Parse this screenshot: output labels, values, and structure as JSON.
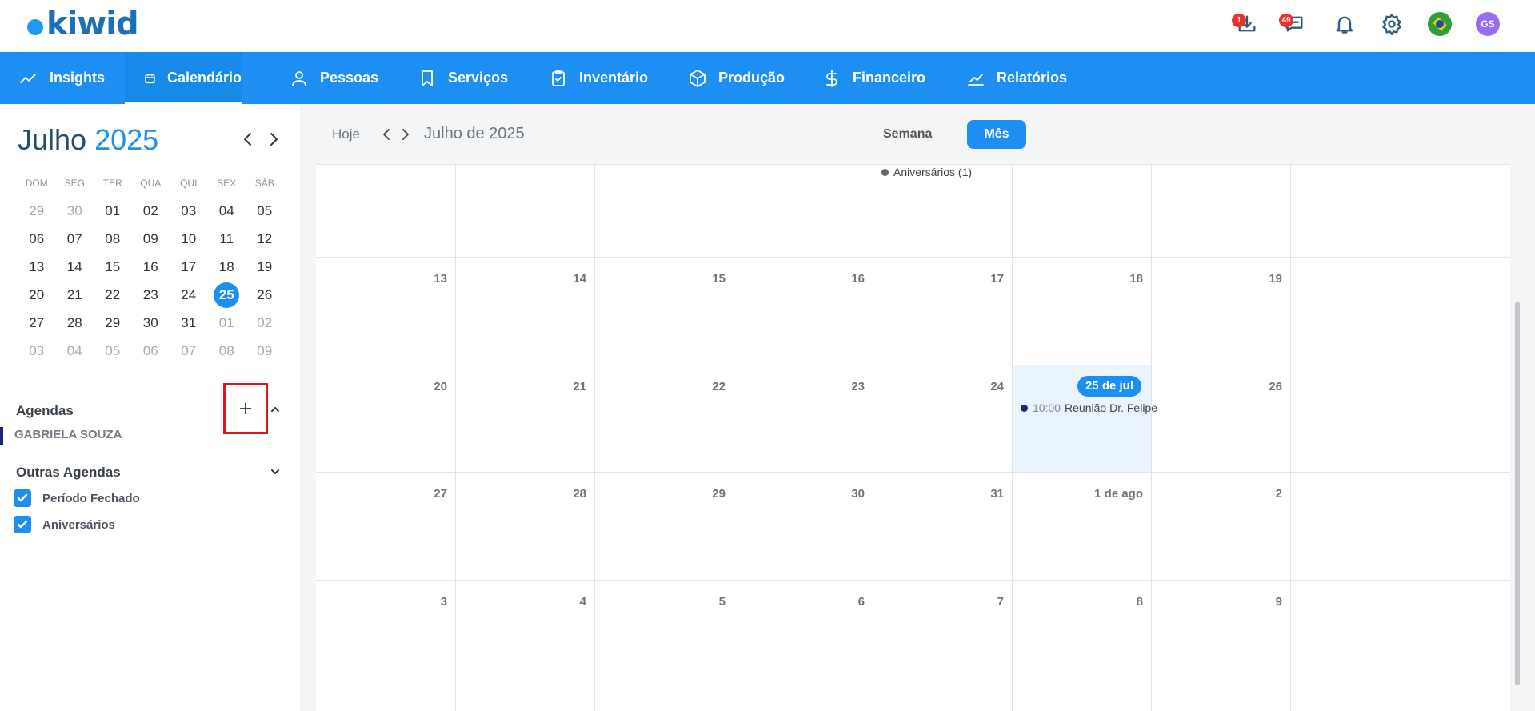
{
  "brand": {
    "logo_text": "kiwid",
    "accent": "#1d8ff2"
  },
  "topbar": {
    "downloads_badge": "1",
    "messages_badge": "49",
    "avatar_initials": "GS"
  },
  "nav": {
    "items": [
      {
        "label": "Insights",
        "icon": "trend-icon"
      },
      {
        "label": "Calendário",
        "icon": "calendar-icon",
        "active": true
      },
      {
        "label": "Pessoas",
        "icon": "person-icon"
      },
      {
        "label": "Serviços",
        "icon": "tooth-icon"
      },
      {
        "label": "Inventário",
        "icon": "clipboard-icon"
      },
      {
        "label": "Produção",
        "icon": "box-icon"
      },
      {
        "label": "Financeiro",
        "icon": "dollar-icon"
      },
      {
        "label": "Relatórios",
        "icon": "chart-icon"
      }
    ]
  },
  "mini_calendar": {
    "month": "Julho",
    "year": "2025",
    "weekdays": [
      "DOM",
      "SEG",
      "TER",
      "QUA",
      "QUI",
      "SEX",
      "SÁB"
    ],
    "weeks": [
      [
        {
          "d": "29",
          "out": true
        },
        {
          "d": "30",
          "out": true
        },
        {
          "d": "01"
        },
        {
          "d": "02"
        },
        {
          "d": "03"
        },
        {
          "d": "04"
        },
        {
          "d": "05"
        }
      ],
      [
        {
          "d": "06"
        },
        {
          "d": "07"
        },
        {
          "d": "08"
        },
        {
          "d": "09"
        },
        {
          "d": "10"
        },
        {
          "d": "11"
        },
        {
          "d": "12"
        }
      ],
      [
        {
          "d": "13"
        },
        {
          "d": "14"
        },
        {
          "d": "15"
        },
        {
          "d": "16"
        },
        {
          "d": "17"
        },
        {
          "d": "18"
        },
        {
          "d": "19"
        }
      ],
      [
        {
          "d": "20"
        },
        {
          "d": "21"
        },
        {
          "d": "22"
        },
        {
          "d": "23"
        },
        {
          "d": "24"
        },
        {
          "d": "25",
          "today": true
        },
        {
          "d": "26"
        }
      ],
      [
        {
          "d": "27"
        },
        {
          "d": "28"
        },
        {
          "d": "29"
        },
        {
          "d": "30"
        },
        {
          "d": "31"
        },
        {
          "d": "01",
          "out": true
        },
        {
          "d": "02",
          "out": true
        }
      ],
      [
        {
          "d": "03",
          "out": true
        },
        {
          "d": "04",
          "out": true
        },
        {
          "d": "05",
          "out": true
        },
        {
          "d": "06",
          "out": true
        },
        {
          "d": "07",
          "out": true
        },
        {
          "d": "08",
          "out": true
        },
        {
          "d": "09",
          "out": true
        }
      ]
    ]
  },
  "agendas": {
    "title": "Agendas",
    "items": [
      "GABRIELA SOUZA"
    ]
  },
  "outras_agendas": {
    "title": "Outras Agendas",
    "items": [
      {
        "label": "Período Fechado",
        "checked": true
      },
      {
        "label": "Aniversários",
        "checked": true
      }
    ]
  },
  "toolbar": {
    "today_label": "Hoje",
    "period_title": "Julho de 2025",
    "week_label": "Semana",
    "month_label": "Mês"
  },
  "month_grid": {
    "rows": [
      {
        "cells": [
          {
            "day": ""
          },
          {
            "day": ""
          },
          {
            "day": ""
          },
          {
            "day": ""
          },
          {
            "day": "",
            "events": [
              {
                "time": "",
                "title": "Aniversários (1)",
                "color": "#666666"
              }
            ]
          },
          {
            "day": ""
          },
          {
            "day": ""
          }
        ]
      },
      {
        "cells": [
          {
            "day": "13"
          },
          {
            "day": "14"
          },
          {
            "day": "15"
          },
          {
            "day": "16"
          },
          {
            "day": "17"
          },
          {
            "day": "18"
          },
          {
            "day": "19"
          }
        ]
      },
      {
        "cells": [
          {
            "day": "20"
          },
          {
            "day": "21"
          },
          {
            "day": "22"
          },
          {
            "day": "23"
          },
          {
            "day": "24"
          },
          {
            "day": "25 de jul",
            "highlight": true,
            "events": [
              {
                "time": "10:00",
                "title": "Reunião Dr. Felipe",
                "color": "#1a237e"
              }
            ]
          },
          {
            "day": "26"
          }
        ]
      },
      {
        "cells": [
          {
            "day": "27"
          },
          {
            "day": "28"
          },
          {
            "day": "29"
          },
          {
            "day": "30"
          },
          {
            "day": "31"
          },
          {
            "day": "1 de ago"
          },
          {
            "day": "2"
          }
        ]
      },
      {
        "cells": [
          {
            "day": "3"
          },
          {
            "day": "4"
          },
          {
            "day": "5"
          },
          {
            "day": "6"
          },
          {
            "day": "7"
          },
          {
            "day": "8"
          },
          {
            "day": "9"
          }
        ]
      }
    ]
  }
}
